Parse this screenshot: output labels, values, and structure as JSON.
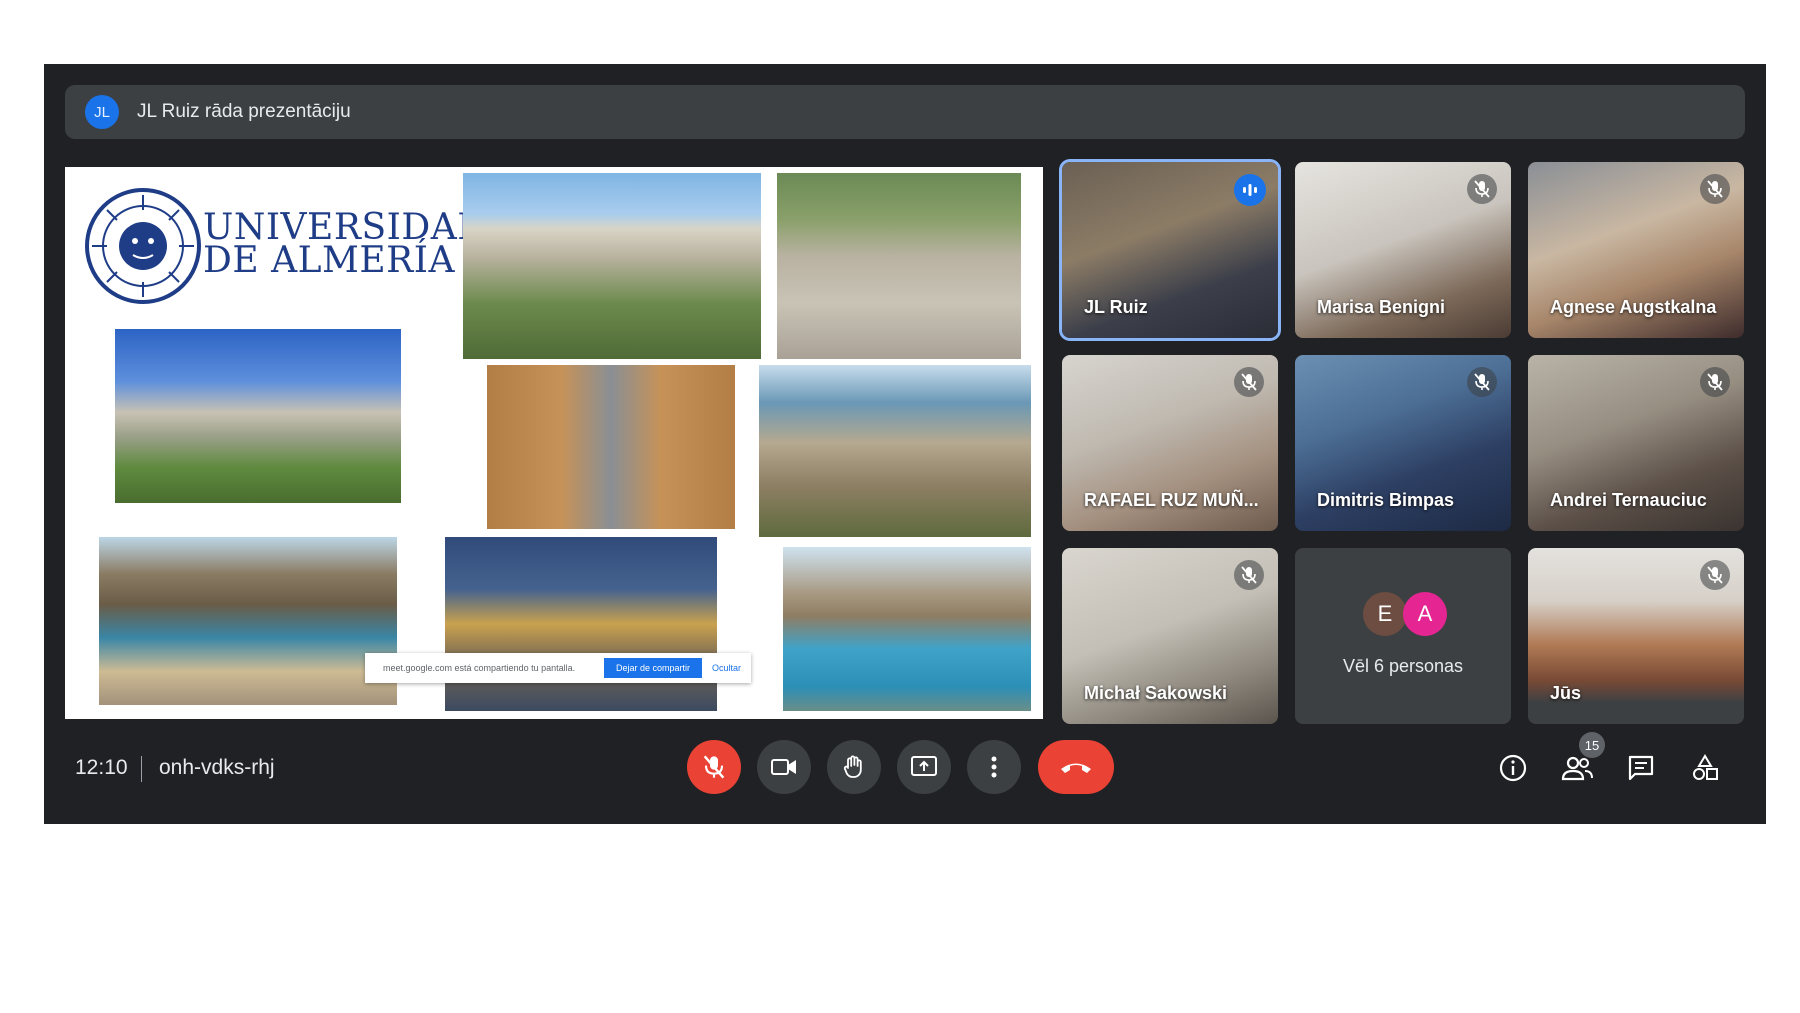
{
  "banner": {
    "avatar_initials": "JL",
    "text": "JL Ruiz rāda prezentāciju"
  },
  "presentation": {
    "university_name_line1": "UNIVERSIDAD",
    "university_name_line2": "DE ALMERÍA",
    "share_bar": {
      "message": "meet.google.com está compartiendo tu pantalla.",
      "stop_label": "Dejar de compartir",
      "hide_label": "Ocultar"
    }
  },
  "participants": [
    {
      "name": "JL Ruiz",
      "speaking": true
    },
    {
      "name": "Marisa Benigni",
      "muted": true
    },
    {
      "name": "Agnese Augstkalna",
      "muted": true
    },
    {
      "name": "RAFAEL RUZ MUÑ...",
      "muted": true
    },
    {
      "name": "Dimitris Bimpas",
      "muted": true
    },
    {
      "name": "Andrei Ternauciuc",
      "muted": true
    },
    {
      "name": "Michał Sakowski",
      "muted": true
    },
    {
      "name": "Jūs",
      "muted": true
    }
  ],
  "more_people": {
    "avatars": [
      "E",
      "A"
    ],
    "label": "Vēl 6 personas"
  },
  "bottom_bar": {
    "time": "12:10",
    "meeting_code": "onh-vdks-rhj",
    "people_count": "15"
  },
  "colors": {
    "background": "#202124",
    "tile": "#3c4043",
    "accent_blue": "#1a73e8",
    "danger_red": "#ea4335"
  },
  "icons": [
    "mic-off-icon",
    "camera-icon",
    "raise-hand-icon",
    "present-icon",
    "more-vert-icon",
    "hangup-icon",
    "info-icon",
    "people-icon",
    "chat-icon",
    "activities-icon"
  ]
}
